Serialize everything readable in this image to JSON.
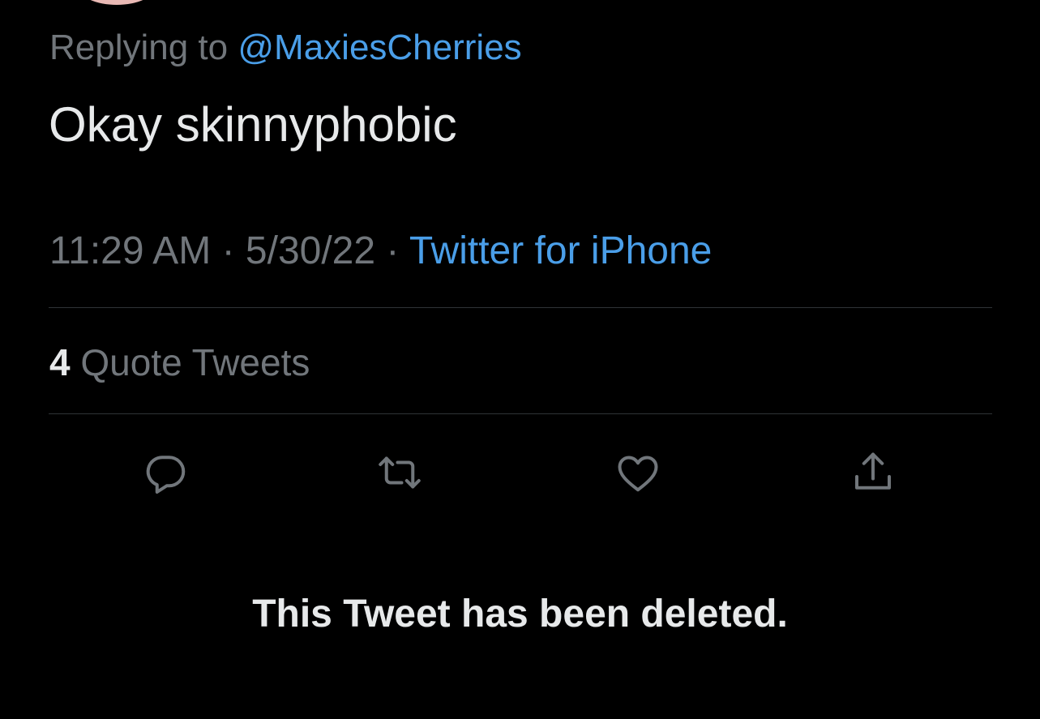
{
  "reply": {
    "prefix": "Replying to",
    "handle": "@MaxiesCherries"
  },
  "tweet": {
    "text": "Okay skinnyphobic"
  },
  "meta": {
    "time": "11:29 AM",
    "separator1": " · ",
    "date": "5/30/22",
    "separator2": " · ",
    "source": "Twitter for iPhone"
  },
  "stats": {
    "quote_count": "4",
    "quote_label": "Quote Tweets"
  },
  "actions": [
    {
      "name": "reply",
      "icon": "speech-bubble-icon"
    },
    {
      "name": "retweet",
      "icon": "retweet-arrows-icon"
    },
    {
      "name": "like",
      "icon": "heart-icon"
    },
    {
      "name": "share",
      "icon": "share-upload-icon"
    }
  ],
  "notice": {
    "deleted": "This Tweet has been deleted."
  },
  "colors": {
    "background": "#000000",
    "primary_text": "#e7e9ea",
    "secondary_text": "#71767b",
    "accent": "#4a9ee8",
    "divider": "#2f3336"
  }
}
